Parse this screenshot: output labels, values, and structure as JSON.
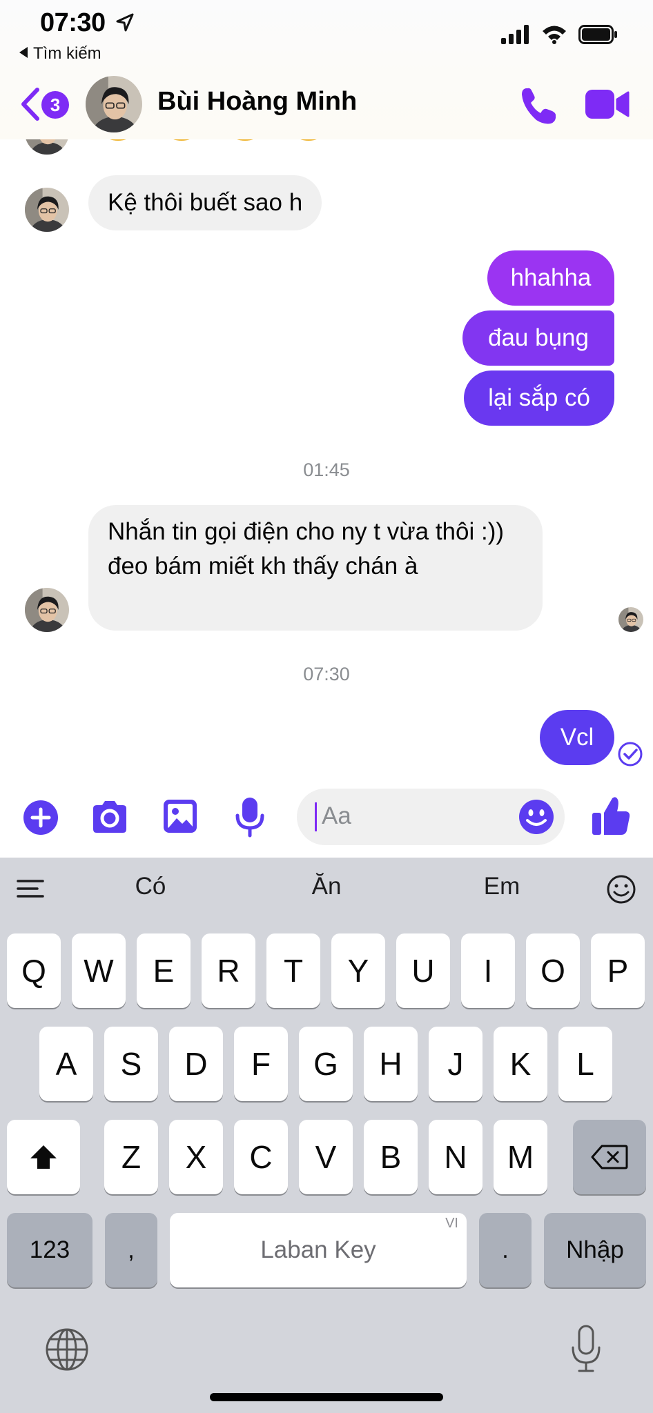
{
  "status_bar": {
    "time": "07:30",
    "back_app": "Tìm kiếm"
  },
  "header": {
    "badge_count": "3",
    "contact_name": "Bùi Hoàng Minh"
  },
  "messages": {
    "m1": "Kệ thôi buết sao h",
    "m2": "hhahha",
    "m3": "đau bụng",
    "m4": "lại sắp có",
    "ts1": "01:45",
    "m5": "Nhắn tin gọi điện cho ny t vừa thôi :)) đeo bám miết kh thấy chán à",
    "ts2": "07:30",
    "m6": "Vcl"
  },
  "composer": {
    "placeholder": "Aa"
  },
  "keyboard": {
    "suggestions": [
      "Có",
      "Ăn",
      "Em"
    ],
    "row1": [
      "Q",
      "W",
      "E",
      "R",
      "T",
      "Y",
      "U",
      "I",
      "O",
      "P"
    ],
    "row2": [
      "A",
      "S",
      "D",
      "F",
      "G",
      "H",
      "J",
      "K",
      "L"
    ],
    "row3": [
      "Z",
      "X",
      "C",
      "V",
      "B",
      "N",
      "M"
    ],
    "numbers_key": "123",
    "comma_key": ",",
    "space_label": "Laban Key",
    "lang_tag": "VI",
    "period_key": ".",
    "return_key": "Nhập"
  },
  "colors": {
    "accent": "#7e2bf5",
    "bubble_out_top": "#a034f0",
    "bubble_out_bottom": "#5b3cf0",
    "bubble_in": "#f0f0f0",
    "keyboard_bg": "#d3d5db"
  },
  "icons": {
    "header": [
      "back-chevron-icon",
      "phone-icon",
      "video-camera-icon"
    ],
    "composer": [
      "plus-icon",
      "camera-icon",
      "image-icon",
      "microphone-icon",
      "emoji-icon",
      "thumbs-up-icon"
    ],
    "keyboard": [
      "menu-icon",
      "smiley-icon",
      "shift-icon",
      "backspace-icon",
      "globe-icon",
      "dictation-mic-icon"
    ]
  }
}
